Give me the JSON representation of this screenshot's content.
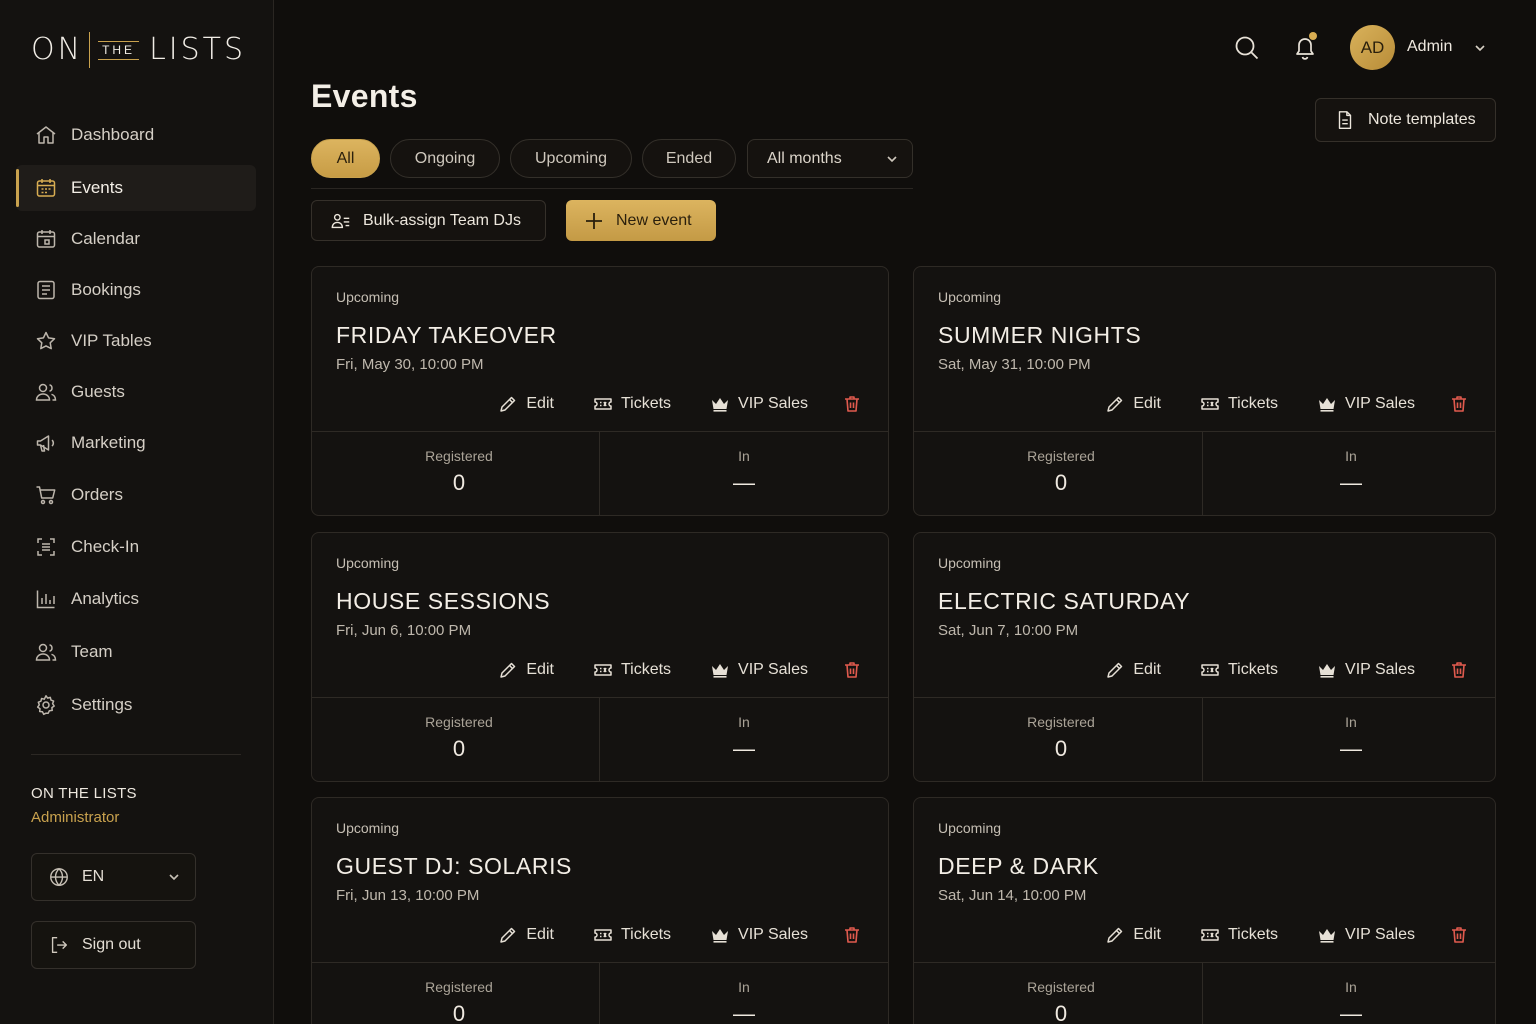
{
  "brand": {
    "left": "ON",
    "middle": "THE",
    "right": "LISTS"
  },
  "sidebar": {
    "items": [
      {
        "label": "Dashboard",
        "icon": "home-icon"
      },
      {
        "label": "Events",
        "icon": "calendar-icon",
        "active": true
      },
      {
        "label": "Calendar",
        "icon": "calendar-icon"
      },
      {
        "label": "Bookings",
        "icon": "document-icon"
      },
      {
        "label": "VIP Tables",
        "icon": "star-icon"
      },
      {
        "label": "Guests",
        "icon": "users-icon"
      },
      {
        "label": "Marketing",
        "icon": "megaphone-icon"
      },
      {
        "label": "Orders",
        "icon": "cart-icon"
      },
      {
        "label": "Check-In",
        "icon": "scan-icon"
      },
      {
        "label": "Analytics",
        "icon": "bar-chart-icon"
      },
      {
        "label": "Team",
        "icon": "team-icon"
      },
      {
        "label": "Settings",
        "icon": "gear-icon"
      }
    ],
    "org_name": "ON THE LISTS",
    "org_role": "Administrator",
    "language": "EN",
    "sign_out": "Sign out"
  },
  "header": {
    "avatar_initials": "AD",
    "user_name": "Admin",
    "page_title": "Events",
    "note_templates": "Note templates"
  },
  "filters": {
    "tabs": [
      {
        "label": "All",
        "active": true
      },
      {
        "label": "Ongoing"
      },
      {
        "label": "Upcoming"
      },
      {
        "label": "Ended"
      }
    ],
    "month": "All months"
  },
  "toolbar": {
    "bulk_assign": "Bulk-assign Team DJs",
    "new_event": "New event"
  },
  "card_labels": {
    "edit": "Edit",
    "tickets": "Tickets",
    "vip_sales": "VIP Sales",
    "registered": "Registered",
    "in": "In"
  },
  "events": [
    {
      "status": "Upcoming",
      "title": "FRIDAY TAKEOVER",
      "date": "Fri, May 30, 10:00 PM",
      "registered": "0",
      "in": "—"
    },
    {
      "status": "Upcoming",
      "title": "SUMMER NIGHTS",
      "date": "Sat, May 31, 10:00 PM",
      "registered": "0",
      "in": "—"
    },
    {
      "status": "Upcoming",
      "title": "HOUSE SESSIONS",
      "date": "Fri, Jun 6, 10:00 PM",
      "registered": "0",
      "in": "—"
    },
    {
      "status": "Upcoming",
      "title": "ELECTRIC SATURDAY",
      "date": "Sat, Jun 7, 10:00 PM",
      "registered": "0",
      "in": "—"
    },
    {
      "status": "Upcoming",
      "title": "GUEST DJ: SOLARIS",
      "date": "Fri, Jun 13, 10:00 PM",
      "registered": "0",
      "in": "—"
    },
    {
      "status": "Upcoming",
      "title": "DEEP & DARK",
      "date": "Sat, Jun 14, 10:00 PM",
      "registered": "0",
      "in": "—"
    }
  ],
  "colors": {
    "accent": "#c9a24e",
    "background": "#100e0c",
    "danger": "#e05a4e"
  }
}
